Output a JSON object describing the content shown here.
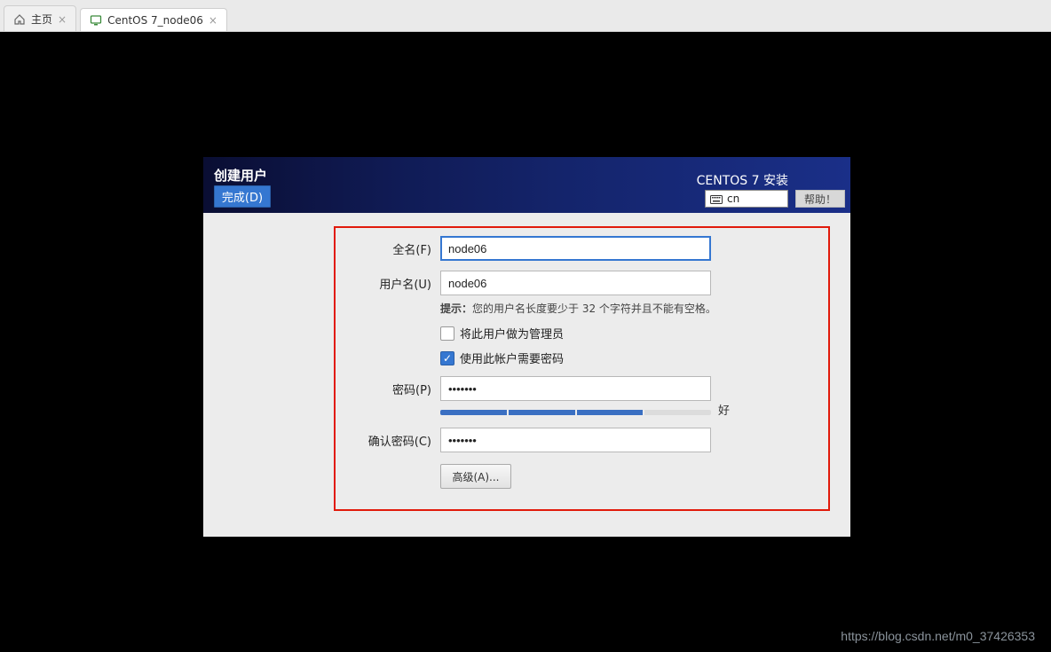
{
  "tabs": {
    "home": {
      "label": "主页"
    },
    "vm": {
      "label": "CentOS 7_node06"
    }
  },
  "header": {
    "title": "创建用户",
    "done": "完成(D)",
    "center": "CENTOS 7 安装",
    "lang": "cn",
    "help": "帮助！"
  },
  "form": {
    "fullname_label": "全名(F)",
    "fullname_value": "node06",
    "username_label": "用户名(U)",
    "username_value": "node06",
    "hint_label": "提示：",
    "hint_text": "您的用户名长度要少于 32 个字符并且不能有空格。",
    "admin_label": "将此用户做为管理员",
    "require_pw_label": "使用此帐户需要密码",
    "password_label": "密码(P)",
    "password_value": "•••••••",
    "strength_text": "好",
    "confirm_label": "确认密码(C)",
    "confirm_value": "•••••••",
    "advanced": "高级(A)..."
  },
  "watermark": "https://blog.csdn.net/m0_37426353"
}
